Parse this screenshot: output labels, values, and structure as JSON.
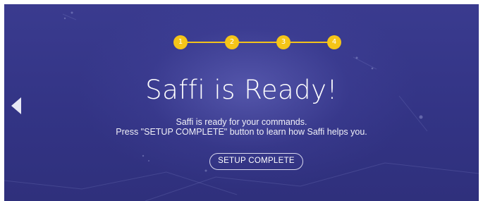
{
  "stepper": {
    "steps": [
      "1",
      "2",
      "3",
      "4"
    ],
    "current_step": 4,
    "accent_color": "#f5c518"
  },
  "main": {
    "title": "Saffi is Ready!",
    "subtitle_line1": "Saffi is ready for your commands.",
    "subtitle_line2": "Press \"SETUP COMPLETE\" button to learn how Saffi helps you.",
    "setup_button_label": "SETUP COMPLETE"
  },
  "nav": {
    "back_icon": "triangle-left-icon"
  },
  "colors": {
    "background": "#353688",
    "text": "#ffffff"
  }
}
